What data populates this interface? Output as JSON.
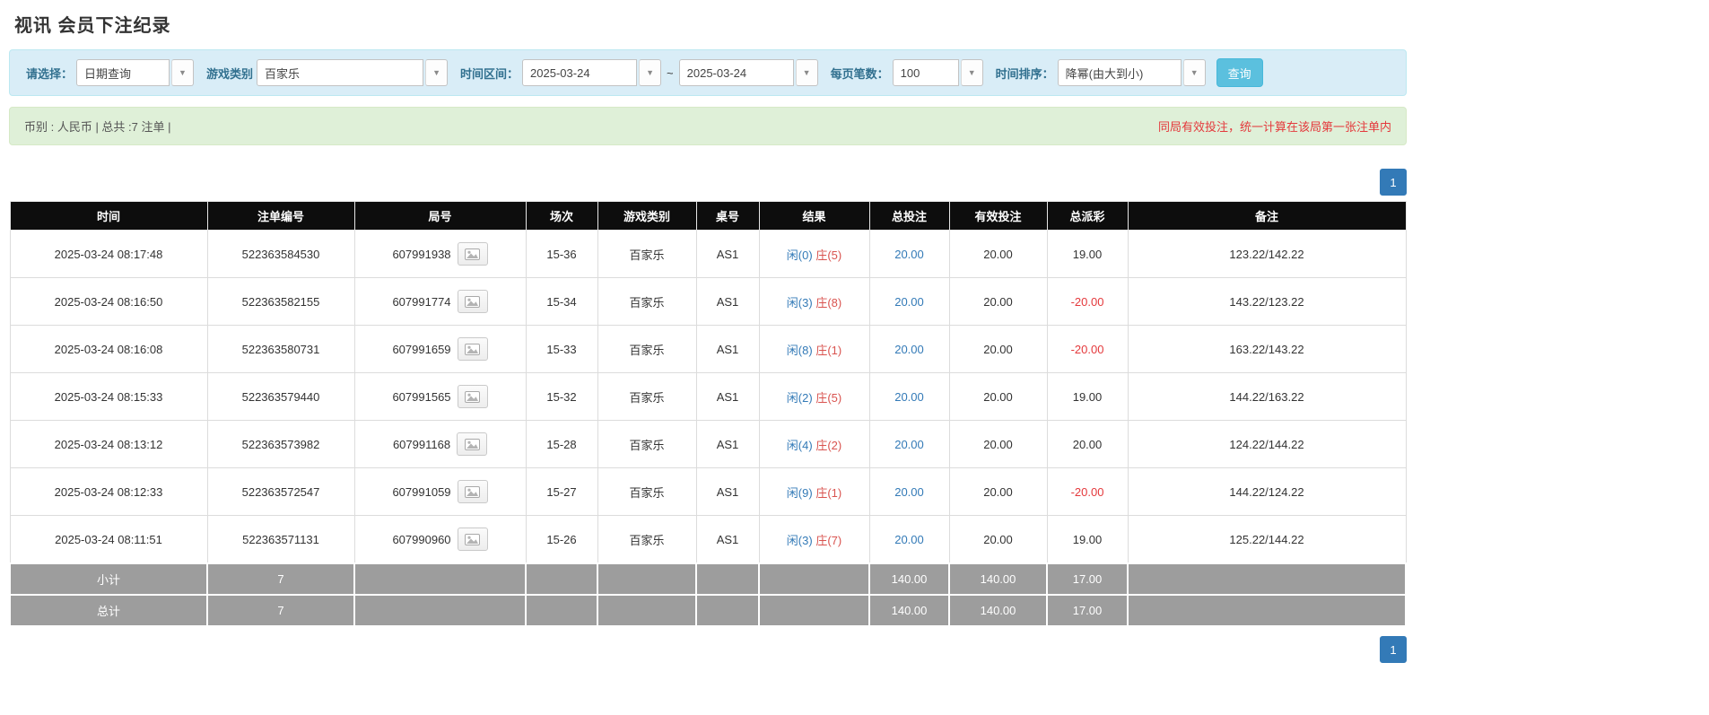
{
  "page": {
    "title": "视讯 会员下注纪录"
  },
  "filters": {
    "select_label": "请选择：",
    "select_value": "日期查询",
    "game_label": "游戏类别",
    "game_value": "百家乐",
    "range_label": "时间区间：",
    "date_from": "2025-03-24",
    "tilde": "~",
    "date_to": "2025-03-24",
    "page_size_label": "每页笔数：",
    "page_size_value": "100",
    "sort_label": "时间排序：",
    "sort_value": "降幂(由大到小)",
    "search_button": "查询",
    "dropdown_arrow_icon": "▼"
  },
  "info_bar": {
    "left": "币别 : 人民币 | 总共 :7 注单 |",
    "right": "同局有效投注，统一计算在该局第一张注单内"
  },
  "pagination": {
    "page": "1"
  },
  "table": {
    "headers": [
      "时间",
      "注单编号",
      "局号",
      "场次",
      "游戏类别",
      "桌号",
      "结果",
      "总投注",
      "有效投注",
      "总派彩",
      "备注"
    ],
    "rows": [
      {
        "time": "2025-03-24 08:17:48",
        "bet_id": "522363584530",
        "round_id": "607991938",
        "session": "15-36",
        "game": "百家乐",
        "table": "AS1",
        "result_player": "闲(0)",
        "result_banker": "庄(5)",
        "total_bet": "20.00",
        "valid_bet": "20.00",
        "payout": "19.00",
        "remark": "123.22/142.22"
      },
      {
        "time": "2025-03-24 08:16:50",
        "bet_id": "522363582155",
        "round_id": "607991774",
        "session": "15-34",
        "game": "百家乐",
        "table": "AS1",
        "result_player": "闲(3)",
        "result_banker": "庄(8)",
        "total_bet": "20.00",
        "valid_bet": "20.00",
        "payout": "-20.00",
        "remark": "143.22/123.22"
      },
      {
        "time": "2025-03-24 08:16:08",
        "bet_id": "522363580731",
        "round_id": "607991659",
        "session": "15-33",
        "game": "百家乐",
        "table": "AS1",
        "result_player": "闲(8)",
        "result_banker": "庄(1)",
        "total_bet": "20.00",
        "valid_bet": "20.00",
        "payout": "-20.00",
        "remark": "163.22/143.22"
      },
      {
        "time": "2025-03-24 08:15:33",
        "bet_id": "522363579440",
        "round_id": "607991565",
        "session": "15-32",
        "game": "百家乐",
        "table": "AS1",
        "result_player": "闲(2)",
        "result_banker": "庄(5)",
        "total_bet": "20.00",
        "valid_bet": "20.00",
        "payout": "19.00",
        "remark": "144.22/163.22"
      },
      {
        "time": "2025-03-24 08:13:12",
        "bet_id": "522363573982",
        "round_id": "607991168",
        "session": "15-28",
        "game": "百家乐",
        "table": "AS1",
        "result_player": "闲(4)",
        "result_banker": "庄(2)",
        "total_bet": "20.00",
        "valid_bet": "20.00",
        "payout": "20.00",
        "remark": "124.22/144.22"
      },
      {
        "time": "2025-03-24 08:12:33",
        "bet_id": "522363572547",
        "round_id": "607991059",
        "session": "15-27",
        "game": "百家乐",
        "table": "AS1",
        "result_player": "闲(9)",
        "result_banker": "庄(1)",
        "total_bet": "20.00",
        "valid_bet": "20.00",
        "payout": "-20.00",
        "remark": "144.22/124.22"
      },
      {
        "time": "2025-03-24 08:11:51",
        "bet_id": "522363571131",
        "round_id": "607990960",
        "session": "15-26",
        "game": "百家乐",
        "table": "AS1",
        "result_player": "闲(3)",
        "result_banker": "庄(7)",
        "total_bet": "20.00",
        "valid_bet": "20.00",
        "payout": "19.00",
        "remark": "125.22/144.22"
      }
    ],
    "subtotal": {
      "label": "小计",
      "count": "7",
      "total_bet": "140.00",
      "valid_bet": "140.00",
      "payout": "17.00"
    },
    "grand_total": {
      "label": "总计",
      "count": "7",
      "total_bet": "140.00",
      "valid_bet": "140.00",
      "payout": "17.00"
    }
  }
}
